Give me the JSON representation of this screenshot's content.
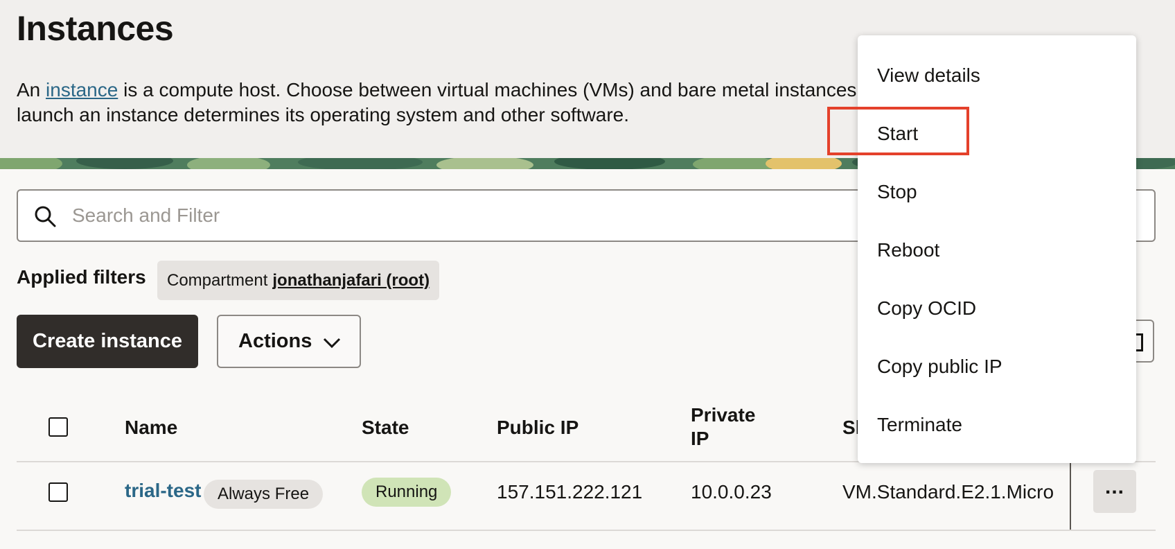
{
  "header": {
    "title": "Instances",
    "desc_prefix": "An",
    "desc_link": "instance",
    "desc_line1_rest": " is a compute host. Choose between virtual machines (VMs) and bare metal instances. The image that you use to",
    "desc_line2": "launch an instance determines its operating system and other software."
  },
  "search": {
    "placeholder": "Search and Filter"
  },
  "filters": {
    "label": "Applied filters",
    "chip_key": "Compartment",
    "chip_value": "jonathanjafari (root)"
  },
  "toolbar": {
    "create_label": "Create instance",
    "actions_label": "Actions"
  },
  "table": {
    "headers": {
      "name": "Name",
      "state": "State",
      "public_ip": "Public IP",
      "private_ip_line1": "Private",
      "private_ip_line2": "IP",
      "shape": "Shape"
    },
    "rows": [
      {
        "name": "trial-test",
        "tag": "Always Free",
        "state": "Running",
        "public_ip": "157.151.222.121",
        "private_ip": "10.0.0.23",
        "shape": "VM.Standard.E2.1.Micro",
        "more_label": "..."
      }
    ]
  },
  "menu": {
    "items": [
      "View details",
      "Start",
      "Stop",
      "Reboot",
      "Copy OCID",
      "Copy public IP",
      "Terminate"
    ]
  },
  "colors": {
    "accent_link": "#2b6787",
    "highlight": "#e4412b",
    "running_badge": "#d0e4b7",
    "primary_button": "#312d2a"
  }
}
